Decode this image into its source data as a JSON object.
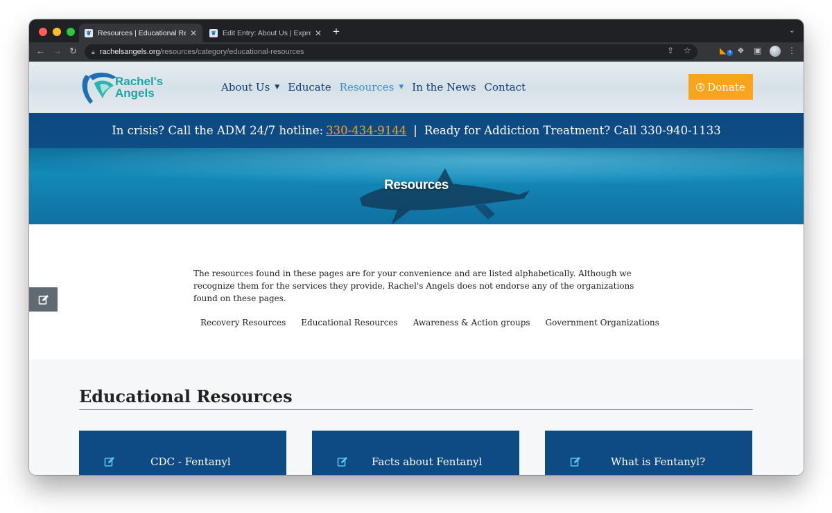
{
  "browser": {
    "tabs": [
      {
        "title": "Resources | Educational Resou",
        "active": true
      },
      {
        "title": "Edit Entry: About Us | Expressi",
        "active": false
      }
    ],
    "url_host": "rachelsangels.org",
    "url_path": "/resources/category/educational-resources",
    "extension_badge": "3"
  },
  "site": {
    "logo": {
      "line1": "Rachel's",
      "line2": "Angels"
    },
    "nav": [
      {
        "label": "About Us",
        "has_dropdown": true,
        "active": false
      },
      {
        "label": "Educate",
        "has_dropdown": false,
        "active": false
      },
      {
        "label": "Resources",
        "has_dropdown": true,
        "active": true
      },
      {
        "label": "In the News",
        "has_dropdown": false,
        "active": false
      },
      {
        "label": "Contact",
        "has_dropdown": false,
        "active": false
      }
    ],
    "donate_label": "Donate",
    "hotline": {
      "prefix": "In crisis? Call the ADM 24/7 hotline:",
      "phone": "330-434-9144",
      "separator": "|",
      "suffix": "Ready for Addiction Treatment? Call 330-940-1133"
    },
    "hero_title": "Resources",
    "intro": "The resources found in these pages are for your convenience and are listed alphabetically. Although we recognize them for the services they provide, Rachel's Angels does not endorse any of the organizations found on these pages.",
    "subnav": [
      "Recovery Resources",
      "Educational Resources",
      "Awareness & Action groups",
      "Government Organizations"
    ],
    "section_title": "Educational Resources",
    "cards": [
      "CDC - Fentanyl",
      "Facts about Fentanyl",
      "What is Fentanyl?"
    ]
  },
  "colors": {
    "brand_blue": "#0e4a84",
    "accent_orange": "#f9a41c",
    "nav_text": "#123e78",
    "nav_active": "#3a8fd2",
    "logo_teal": "#1aa6a6"
  }
}
